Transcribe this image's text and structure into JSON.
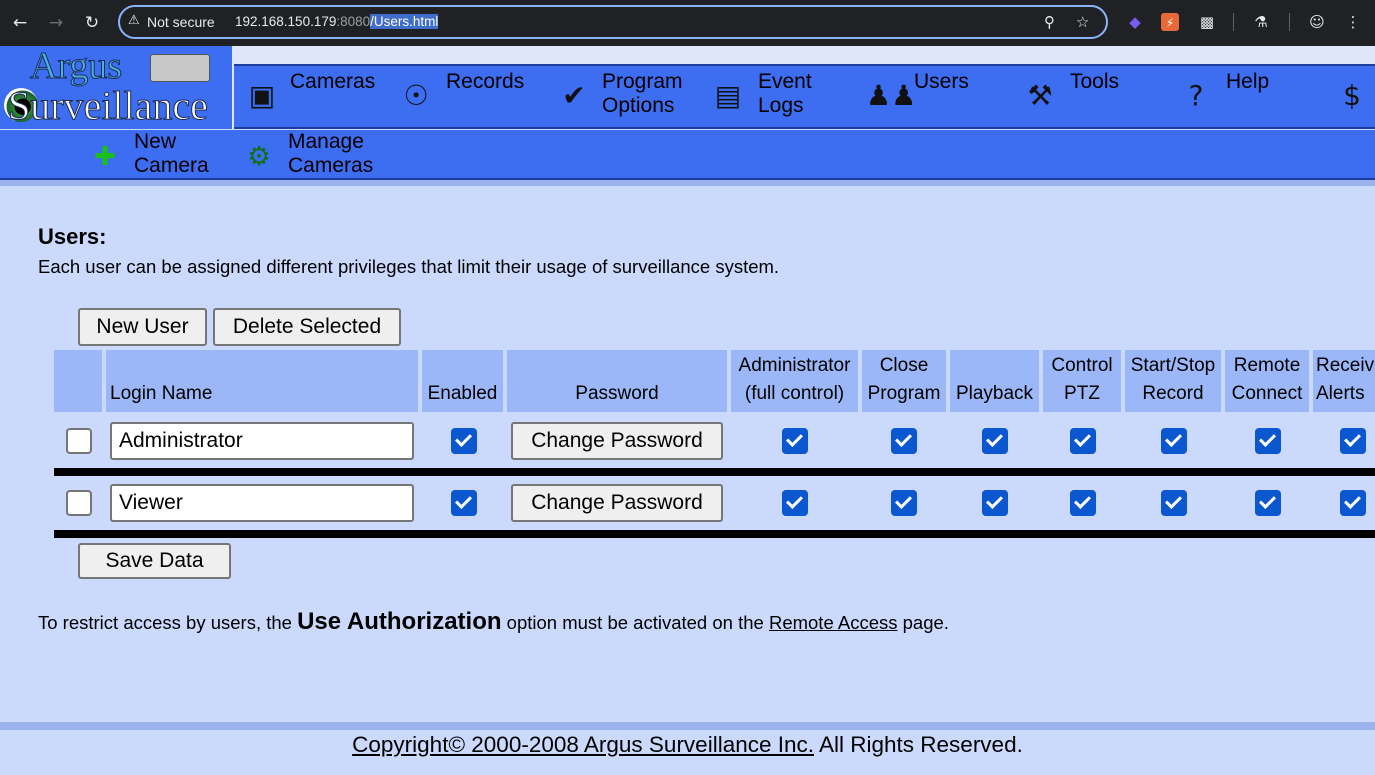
{
  "browser": {
    "security_label": "Not secure",
    "url_host": "192.168.150.179",
    "url_port": ":8080",
    "url_path": "/Users.html"
  },
  "logo": {
    "line1": "Argus",
    "line2": "Surveillance"
  },
  "nav": {
    "items": [
      {
        "label": "Cameras",
        "icon": "camera-icon"
      },
      {
        "label": "Records",
        "icon": "disc-icon"
      },
      {
        "label": "Program\nOptions",
        "icon": "checkmark-icon"
      },
      {
        "label": "Event\nLogs",
        "icon": "document-icon"
      },
      {
        "label": "Users",
        "icon": "users-icon"
      },
      {
        "label": "Tools",
        "icon": "tools-icon"
      },
      {
        "label": "Help",
        "icon": "help-icon"
      },
      {
        "label": "",
        "icon": "dollar-icon"
      }
    ]
  },
  "subnav": {
    "items": [
      {
        "label": "New\nCamera",
        "icon": "new-camera-icon"
      },
      {
        "label": "Manage\nCameras",
        "icon": "manage-cameras-icon"
      }
    ]
  },
  "page": {
    "title": "Users:",
    "description": "Each user can be assigned different privileges that limit their usage of surveillance system."
  },
  "buttons": {
    "new_user": "New User",
    "delete_selected": "Delete Selected",
    "save_data": "Save Data",
    "change_password": "Change Password"
  },
  "table": {
    "headers": [
      "",
      "Login Name",
      "Enabled",
      "Password",
      "Administrator\n(full control)",
      "Close\nProgram",
      "Playback",
      "Control\nPTZ",
      "Start/Stop\nRecord",
      "Remote\nConnect",
      "Receive\nAlerts"
    ],
    "rows": [
      {
        "selected": false,
        "login": "Administrator",
        "enabled": true,
        "admin": true,
        "close_program": true,
        "playback": true,
        "control_ptz": true,
        "start_stop": true,
        "remote_connect": true,
        "receive_alerts": true
      },
      {
        "selected": false,
        "login": "Viewer",
        "enabled": true,
        "admin": true,
        "close_program": true,
        "playback": true,
        "control_ptz": true,
        "start_stop": true,
        "remote_connect": true,
        "receive_alerts": true
      }
    ]
  },
  "note": {
    "prefix": "To restrict access by users, the ",
    "emphasis": "Use Authorization",
    "middle": " option must be activated on the ",
    "link": "Remote Access",
    "suffix": " page."
  },
  "footer": {
    "copyright": "Copyright© 2000-2008 Argus Surveillance Inc.",
    "rights": " All Rights Reserved."
  },
  "colors": {
    "page_bg": "#cad9fc",
    "nav_bg": "#3d6df0",
    "header_cell": "#9bb7f7",
    "checkbox_on": "#0b57d0"
  }
}
